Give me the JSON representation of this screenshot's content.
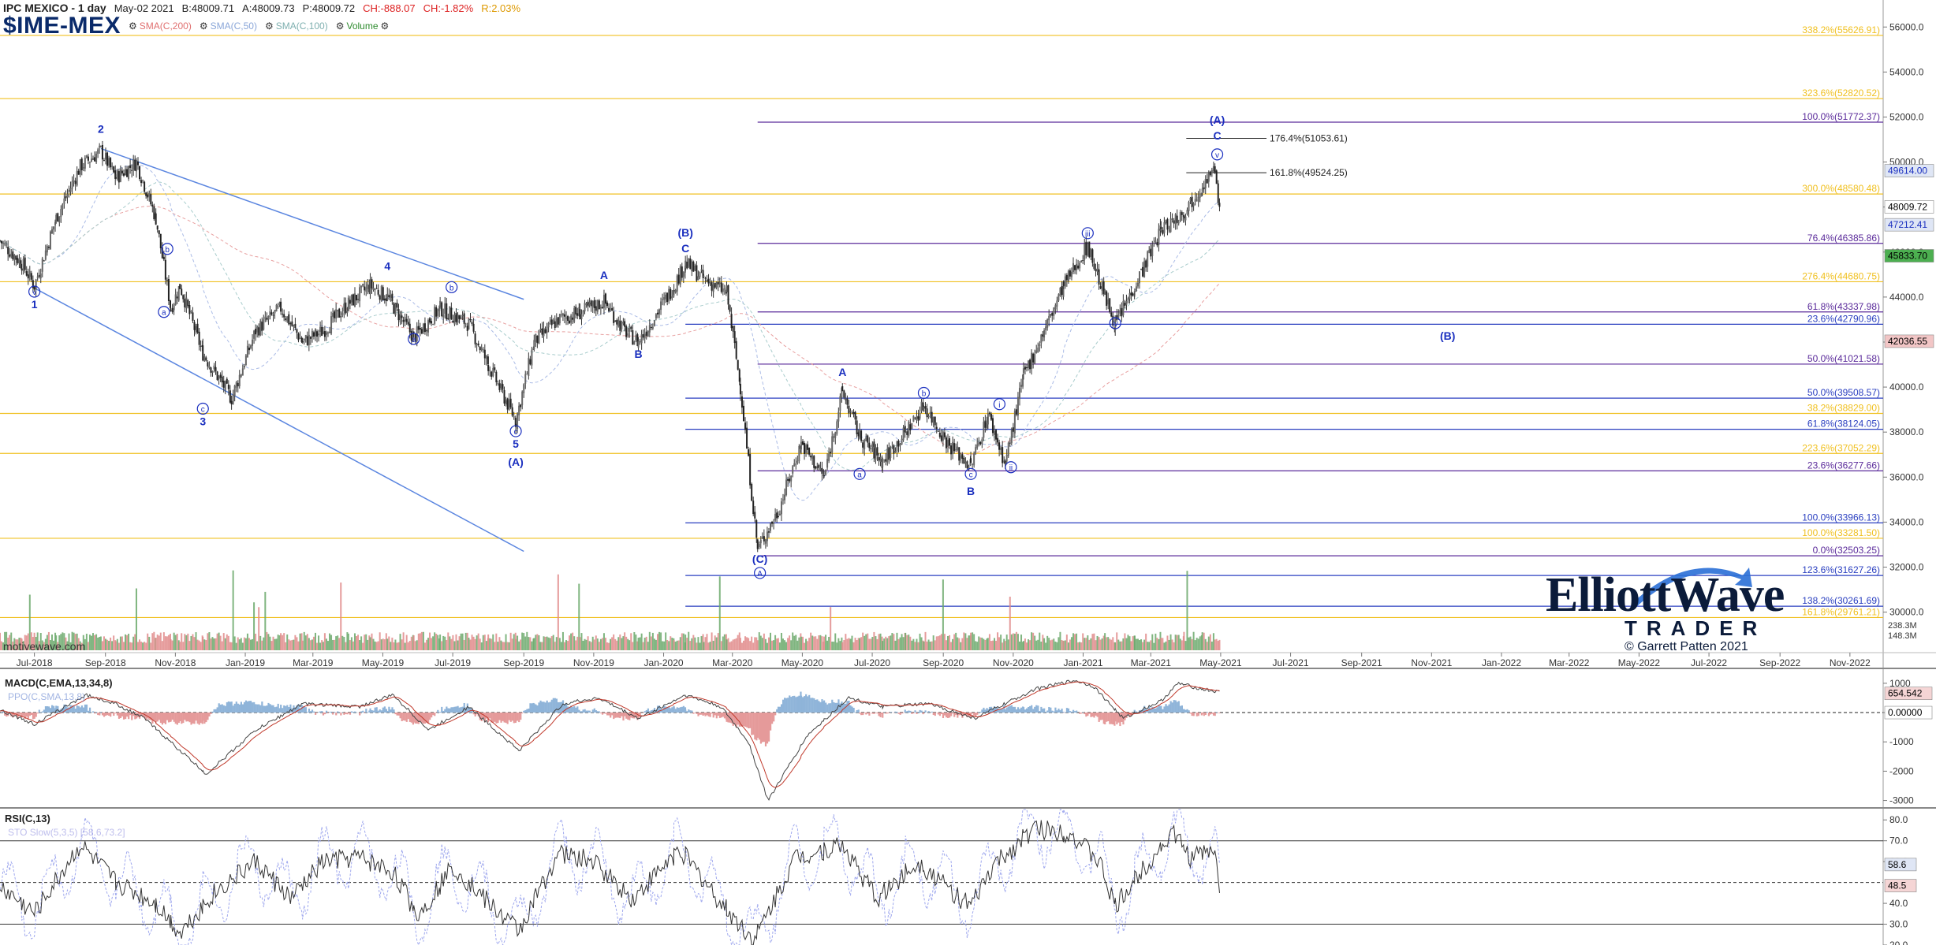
{
  "header": {
    "title": "IPC MEXICO - 1 day",
    "date": "May-02 2021",
    "bid": "B:48009.71",
    "ask": "A:48009.73",
    "price": "P:48009.72",
    "change": "CH:-888.07",
    "change_pct": "CH:-1.82%",
    "range": "R:2.03%",
    "symbol": "$IME-MEX",
    "indicators": [
      {
        "label": "SMA(C,200)",
        "color": "#e07070",
        "icon": "gear-icon"
      },
      {
        "label": "SMA(C,50)",
        "color": "#8aa6d8",
        "icon": "gear-icon"
      },
      {
        "label": "SMA(C,100)",
        "color": "#7fb0b0",
        "icon": "gear-icon"
      },
      {
        "label": "Volume",
        "color": "#2e8b2e",
        "icon": "gear-icon"
      }
    ]
  },
  "watermark": "motivewave.com",
  "logo": {
    "main": "ElliottWave",
    "sub": "TRADER",
    "copyright": "© Garrett Patten 2021"
  },
  "colors": {
    "fib_orange": "#f0c020",
    "fib_blue": "#2a3fc0",
    "fib_purple": "#5a2a9a",
    "trend": "#5b86e0",
    "wave_label": "#1a2fbf",
    "candle": "#333333",
    "volume_up": "#6aa86a",
    "volume_down": "#e08a8a"
  },
  "chart_data": {
    "type": "candlestick",
    "x_range": [
      "2018-06-01",
      "2022-11-30"
    ],
    "price_axis": {
      "ylim": [
        28200,
        57200
      ],
      "ticks": [
        30000,
        32000,
        34000,
        36000,
        38000,
        40000,
        42000,
        44000,
        46000,
        48000,
        50000,
        52000,
        54000,
        56000
      ],
      "tick_labels": [
        "30000.0",
        "32000.0",
        "34000.0",
        "36000.0",
        "38000.0",
        "40000.0",
        "42000.0",
        "44000.0",
        "46000.0",
        "48000.0",
        "50000.0",
        "52000.0",
        "54000.0",
        "56000.0"
      ],
      "badges": [
        {
          "text": "49614.00",
          "value": 49614,
          "bg": "#dfe6f5",
          "fg": "#1a2fbf"
        },
        {
          "text": "48009.72",
          "value": 48009.72,
          "bg": "#ffffff",
          "fg": "#000000"
        },
        {
          "text": "47212.41",
          "value": 47212.41,
          "bg": "#dfe6f5",
          "fg": "#1a2fbf"
        },
        {
          "text": "45833.70",
          "value": 45833.7,
          "bg": "#4caf50",
          "fg": "#000000"
        },
        {
          "text": "42036.55",
          "value": 42036.55,
          "bg": "#f2c6c6",
          "fg": "#000000"
        }
      ],
      "volume_labels": [
        "238.3M",
        "148.3M"
      ]
    },
    "x_ticks": [
      "Jul-2018",
      "Sep-2018",
      "Nov-2018",
      "Jan-2019",
      "Mar-2019",
      "May-2019",
      "Jul-2019",
      "Sep-2019",
      "Nov-2019",
      "Jan-2020",
      "Mar-2020",
      "May-2020",
      "Jul-2020",
      "Sep-2020",
      "Nov-2020",
      "Jan-2021",
      "Mar-2021",
      "May-2021",
      "Jul-2021",
      "Sep-2021",
      "Nov-2021",
      "Jan-2022",
      "Mar-2022",
      "May-2022",
      "Jul-2022",
      "Sep-2022",
      "Nov-2022"
    ],
    "price_path": [
      [
        "2018-06-01",
        46500
      ],
      [
        "2018-06-20",
        45500
      ],
      [
        "2018-07-01",
        44500
      ],
      [
        "2018-07-20",
        47500
      ],
      [
        "2018-08-10",
        49800
      ],
      [
        "2018-08-28",
        50500
      ],
      [
        "2018-09-10",
        49300
      ],
      [
        "2018-09-28",
        50000
      ],
      [
        "2018-10-15",
        47500
      ],
      [
        "2018-10-28",
        43500
      ],
      [
        "2018-11-05",
        44500
      ],
      [
        "2018-11-25",
        41500
      ],
      [
        "2018-12-20",
        39500
      ],
      [
        "2019-01-10",
        42500
      ],
      [
        "2019-02-01",
        43500
      ],
      [
        "2019-02-20",
        42000
      ],
      [
        "2019-03-10",
        42500
      ],
      [
        "2019-04-01",
        43700
      ],
      [
        "2019-04-20",
        44500
      ],
      [
        "2019-05-05",
        44000
      ],
      [
        "2019-05-28",
        42200
      ],
      [
        "2019-06-20",
        43500
      ],
      [
        "2019-07-15",
        42800
      ],
      [
        "2019-08-01",
        41000
      ],
      [
        "2019-08-25",
        38500
      ],
      [
        "2019-09-10",
        42000
      ],
      [
        "2019-10-01",
        43000
      ],
      [
        "2019-10-20",
        43300
      ],
      [
        "2019-11-10",
        43800
      ],
      [
        "2019-11-28",
        42500
      ],
      [
        "2019-12-10",
        42000
      ],
      [
        "2020-01-10",
        44500
      ],
      [
        "2020-01-20",
        45500
      ],
      [
        "2020-02-05",
        44800
      ],
      [
        "2020-02-25",
        44200
      ],
      [
        "2020-03-08",
        40000
      ],
      [
        "2020-03-23",
        32800
      ],
      [
        "2020-04-10",
        34500
      ],
      [
        "2020-04-30",
        37500
      ],
      [
        "2020-05-20",
        36000
      ],
      [
        "2020-06-05",
        39800
      ],
      [
        "2020-06-20",
        37800
      ],
      [
        "2020-07-10",
        36700
      ],
      [
        "2020-07-30",
        38000
      ],
      [
        "2020-08-15",
        39200
      ],
      [
        "2020-09-05",
        37500
      ],
      [
        "2020-09-25",
        36500
      ],
      [
        "2020-10-10",
        38800
      ],
      [
        "2020-10-25",
        36600
      ],
      [
        "2020-11-10",
        40500
      ],
      [
        "2020-11-28",
        42500
      ],
      [
        "2020-12-15",
        44500
      ],
      [
        "2021-01-05",
        46300
      ],
      [
        "2021-01-20",
        44000
      ],
      [
        "2021-01-29",
        42800
      ],
      [
        "2021-02-15",
        44500
      ],
      [
        "2021-03-10",
        47000
      ],
      [
        "2021-03-30",
        47800
      ],
      [
        "2021-04-15",
        49000
      ],
      [
        "2021-04-26",
        49600
      ],
      [
        "2021-04-30",
        48009.72
      ]
    ],
    "volume": {
      "ylim": [
        0,
        600
      ],
      "seed": 7
    },
    "fib_lines": [
      {
        "label": "338.2%(55626.91)",
        "value": 55626.91,
        "color": "fib_orange",
        "x_start": "2018-06-01"
      },
      {
        "label": "323.6%(52820.52)",
        "value": 52820.52,
        "color": "fib_orange",
        "x_start": "2018-06-01"
      },
      {
        "label": "100.0%(51772.37)",
        "value": 51772.37,
        "color": "fib_purple",
        "x_start": "2020-03-23"
      },
      {
        "label": "300.0%(48580.48)",
        "value": 48580.48,
        "color": "fib_orange",
        "x_start": "2018-06-01"
      },
      {
        "label": "76.4%(46385.86)",
        "value": 46385.86,
        "color": "fib_purple",
        "x_start": "2020-03-23"
      },
      {
        "label": "276.4%(44680.75)",
        "value": 44680.75,
        "color": "fib_orange",
        "x_start": "2018-06-01"
      },
      {
        "label": "61.8%(43337.98)",
        "value": 43337.98,
        "color": "fib_purple",
        "x_start": "2020-03-23"
      },
      {
        "label": "23.6%(42790.96)",
        "value": 42790.96,
        "color": "fib_blue",
        "x_start": "2020-01-20"
      },
      {
        "label": "50.0%(41021.58)",
        "value": 41021.58,
        "color": "fib_purple",
        "x_start": "2020-03-23"
      },
      {
        "label": "50.0%(39508.57)",
        "value": 39508.57,
        "color": "fib_blue",
        "x_start": "2020-01-20"
      },
      {
        "label": "38.2%(38829.00)",
        "value": 38829.0,
        "color": "fib_orange",
        "x_start": "2018-06-01"
      },
      {
        "label": "61.8%(38124.05)",
        "value": 38124.05,
        "color": "fib_blue",
        "x_start": "2020-01-20"
      },
      {
        "label": "223.6%(37052.29)",
        "value": 37052.29,
        "color": "fib_orange",
        "x_start": "2018-06-01"
      },
      {
        "label": "23.6%(36277.66)",
        "value": 36277.66,
        "color": "fib_purple",
        "x_start": "2020-03-23"
      },
      {
        "label": "100.0%(33966.13)",
        "value": 33966.13,
        "color": "fib_blue",
        "x_start": "2020-01-20"
      },
      {
        "label": "100.0%(33281.50)",
        "value": 33281.5,
        "color": "fib_orange",
        "x_start": "2018-06-01"
      },
      {
        "label": "0.0%(32503.25)",
        "value": 32503.25,
        "color": "fib_purple",
        "x_start": "2020-03-23"
      },
      {
        "label": "123.6%(31627.26)",
        "value": 31627.26,
        "color": "fib_blue",
        "x_start": "2020-01-20"
      },
      {
        "label": "138.2%(30261.69)",
        "value": 30261.69,
        "color": "fib_blue",
        "x_start": "2020-01-20"
      },
      {
        "label": "161.8%(29761.21)",
        "value": 29761.21,
        "color": "fib_orange",
        "x_start": "2018-06-01"
      }
    ],
    "target_lines": [
      {
        "label": "176.4%(51053.61)",
        "value": 51053.61,
        "x_start": "2021-04-01",
        "x_end": "2021-06-10"
      },
      {
        "label": "161.8%(49524.25)",
        "value": 49524.25,
        "x_start": "2021-04-01",
        "x_end": "2021-06-10"
      }
    ],
    "trendlines": [
      {
        "from": [
          "2018-08-28",
          50600
        ],
        "to": [
          "2019-09-01",
          43900
        ]
      },
      {
        "from": [
          "2018-07-01",
          44400
        ],
        "to": [
          "2019-09-01",
          32700
        ]
      }
    ],
    "wave_labels": [
      {
        "text": "v",
        "x": "2018-07-01",
        "y": 44100,
        "circled": true
      },
      {
        "text": "1",
        "x": "2018-07-01",
        "y": 43500,
        "circled": false
      },
      {
        "text": "2",
        "x": "2018-08-28",
        "y": 51300,
        "circled": false
      },
      {
        "text": "b",
        "x": "2018-10-25",
        "y": 46000,
        "circled": true
      },
      {
        "text": "a",
        "x": "2018-10-22",
        "y": 43200,
        "circled": true
      },
      {
        "text": "c",
        "x": "2018-11-25",
        "y": 38900,
        "circled": true
      },
      {
        "text": "3",
        "x": "2018-11-25",
        "y": 38300,
        "circled": false
      },
      {
        "text": "4",
        "x": "2019-05-05",
        "y": 45200,
        "circled": false
      },
      {
        "text": "b",
        "x": "2019-06-30",
        "y": 44300,
        "circled": true
      },
      {
        "text": "a",
        "x": "2019-05-28",
        "y": 42000,
        "circled": true
      },
      {
        "text": "c",
        "x": "2019-08-25",
        "y": 37900,
        "circled": true
      },
      {
        "text": "5",
        "x": "2019-08-25",
        "y": 37300,
        "circled": false
      },
      {
        "text": "(A)",
        "x": "2019-08-25",
        "y": 36500,
        "circled": false
      },
      {
        "text": "A",
        "x": "2019-11-10",
        "y": 44800,
        "circled": false
      },
      {
        "text": "B",
        "x": "2019-12-10",
        "y": 41300,
        "circled": false
      },
      {
        "text": "(B)",
        "x": "2020-01-20",
        "y": 46700,
        "circled": false
      },
      {
        "text": "C",
        "x": "2020-01-20",
        "y": 46000,
        "circled": false
      },
      {
        "text": "(C)",
        "x": "2020-03-25",
        "y": 32200,
        "circled": false
      },
      {
        "text": "A",
        "x": "2020-03-25",
        "y": 31600,
        "circled": true
      },
      {
        "text": "A",
        "x": "2020-06-05",
        "y": 40500,
        "circled": false
      },
      {
        "text": "a",
        "x": "2020-06-20",
        "y": 36000,
        "circled": true
      },
      {
        "text": "b",
        "x": "2020-08-15",
        "y": 39600,
        "circled": true
      },
      {
        "text": "c",
        "x": "2020-09-25",
        "y": 36000,
        "circled": true
      },
      {
        "text": "B",
        "x": "2020-09-25",
        "y": 35200,
        "circled": false
      },
      {
        "text": "i",
        "x": "2020-10-20",
        "y": 39100,
        "circled": true
      },
      {
        "text": "ii",
        "x": "2020-10-30",
        "y": 36300,
        "circled": true
      },
      {
        "text": "iii",
        "x": "2021-01-05",
        "y": 46700,
        "circled": true
      },
      {
        "text": "iv",
        "x": "2021-01-29",
        "y": 42700,
        "circled": true
      },
      {
        "text": "v",
        "x": "2021-04-28",
        "y": 50200,
        "circled": true
      },
      {
        "text": "C",
        "x": "2021-04-28",
        "y": 51000,
        "circled": false
      },
      {
        "text": "(A)",
        "x": "2021-04-28",
        "y": 51700,
        "circled": false
      },
      {
        "text": "(B)",
        "x": "2021-11-15",
        "y": 42100,
        "circled": false
      }
    ],
    "macd": {
      "title": "MACD(C,EMA,13,34,8)",
      "sub": "PPO(C,SMA,13,8)",
      "ylim": [
        -3200,
        1400
      ],
      "ticks": [
        1000,
        0,
        -1000,
        -2000,
        -3000
      ],
      "tick_labels": [
        "1000",
        "0.00000",
        "-1000",
        "-2000",
        "-3000"
      ],
      "badges": [
        {
          "text": "654.542",
          "value": 654.542
        },
        {
          "text": "0.00000",
          "value": 0
        }
      ],
      "path": [
        [
          "2018-06-01",
          100
        ],
        [
          "2018-07-01",
          -400
        ],
        [
          "2018-08-15",
          600
        ],
        [
          "2018-09-10",
          300
        ],
        [
          "2018-10-05",
          -200
        ],
        [
          "2018-11-28",
          -2100
        ],
        [
          "2019-01-10",
          -600
        ],
        [
          "2019-02-20",
          300
        ],
        [
          "2019-04-10",
          200
        ],
        [
          "2019-05-10",
          600
        ],
        [
          "2019-06-10",
          -600
        ],
        [
          "2019-07-15",
          200
        ],
        [
          "2019-08-28",
          -1300
        ],
        [
          "2019-10-05",
          300
        ],
        [
          "2019-11-05",
          500
        ],
        [
          "2019-12-10",
          -200
        ],
        [
          "2020-01-20",
          600
        ],
        [
          "2020-02-20",
          200
        ],
        [
          "2020-03-15",
          -1000
        ],
        [
          "2020-04-01",
          -3000
        ],
        [
          "2020-05-05",
          -800
        ],
        [
          "2020-06-10",
          500
        ],
        [
          "2020-07-10",
          200
        ],
        [
          "2020-08-20",
          300
        ],
        [
          "2020-09-28",
          -200
        ],
        [
          "2020-10-25",
          300
        ],
        [
          "2020-11-20",
          800
        ],
        [
          "2020-12-25",
          1100
        ],
        [
          "2021-01-10",
          900
        ],
        [
          "2021-02-05",
          -200
        ],
        [
          "2021-03-10",
          400
        ],
        [
          "2021-03-25",
          1000
        ],
        [
          "2021-04-15",
          800
        ],
        [
          "2021-04-30",
          700
        ]
      ]
    },
    "rsi": {
      "title": "RSI(C,13)",
      "sub": "STO Slow(5,3,5) [58.6,73.2]",
      "ylim": [
        20,
        85
      ],
      "ticks": [
        80,
        70,
        60,
        40,
        30,
        20
      ],
      "tick_labels": [
        "80.0",
        "70.0",
        "60.0",
        "40.0",
        "30.0",
        "20.0"
      ],
      "levels": [
        70,
        50,
        30
      ],
      "badges": [
        {
          "text": "58.6",
          "value": 58.6
        },
        {
          "text": "48.5",
          "value": 48.5
        }
      ],
      "path": [
        [
          "2018-06-01",
          48
        ],
        [
          "2018-07-01",
          35
        ],
        [
          "2018-08-10",
          68
        ],
        [
          "2018-09-10",
          50
        ],
        [
          "2018-10-15",
          40
        ],
        [
          "2018-11-05",
          26
        ],
        [
          "2018-12-05",
          45
        ],
        [
          "2019-01-10",
          60
        ],
        [
          "2019-02-10",
          42
        ],
        [
          "2019-03-10",
          60
        ],
        [
          "2019-04-10",
          62
        ],
        [
          "2019-05-10",
          55
        ],
        [
          "2019-06-01",
          34
        ],
        [
          "2019-07-01",
          58
        ],
        [
          "2019-08-05",
          38
        ],
        [
          "2019-08-28",
          27
        ],
        [
          "2019-10-01",
          64
        ],
        [
          "2019-11-01",
          60
        ],
        [
          "2019-12-05",
          42
        ],
        [
          "2020-01-15",
          66
        ],
        [
          "2020-02-20",
          40
        ],
        [
          "2020-03-20",
          22
        ],
        [
          "2020-04-25",
          62
        ],
        [
          "2020-06-05",
          68
        ],
        [
          "2020-07-05",
          42
        ],
        [
          "2020-08-10",
          60
        ],
        [
          "2020-09-25",
          38
        ],
        [
          "2020-10-15",
          58
        ],
        [
          "2020-11-20",
          76
        ],
        [
          "2020-12-20",
          74
        ],
        [
          "2021-01-15",
          60
        ],
        [
          "2021-01-29",
          38
        ],
        [
          "2021-02-20",
          55
        ],
        [
          "2021-03-20",
          74
        ],
        [
          "2021-04-05",
          62
        ],
        [
          "2021-04-25",
          66
        ],
        [
          "2021-04-30",
          48.5
        ]
      ]
    }
  }
}
